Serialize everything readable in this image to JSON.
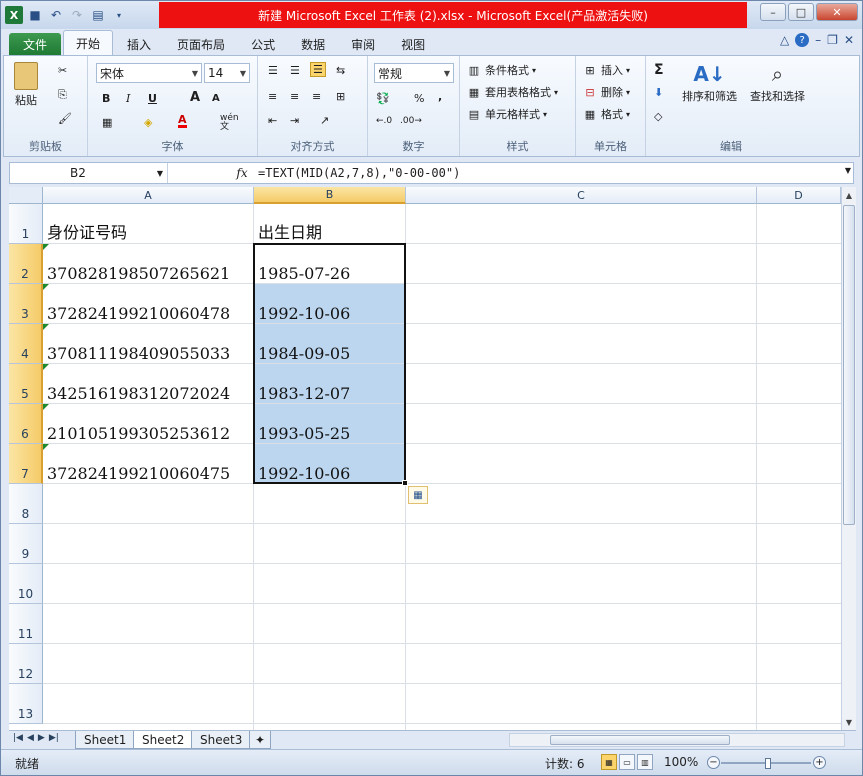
{
  "window": {
    "title": "新建 Microsoft Excel 工作表 (2).xlsx - Microsoft Excel(产品激活失败)"
  },
  "tabs": [
    "文件",
    "开始",
    "插入",
    "页面布局",
    "公式",
    "数据",
    "审阅",
    "视图"
  ],
  "ribbon": {
    "clipboard": {
      "paste": "粘贴",
      "label": "剪贴板"
    },
    "font": {
      "name": "宋体",
      "size": "14",
      "bold": "B",
      "italic": "I",
      "underline": "U",
      "grow": "A",
      "shrink": "A",
      "fontcolor": "A",
      "wen": "wén\n文",
      "label": "字体"
    },
    "align": {
      "label": "对齐方式"
    },
    "number": {
      "format": "常规",
      "percent": "%",
      "comma": ",",
      "label": "数字"
    },
    "styles": {
      "cond": "条件格式",
      "table": "套用表格格式",
      "cell": "单元格样式",
      "label": "样式"
    },
    "cells": {
      "insert": "插入",
      "delete": "删除",
      "format": "格式",
      "label": "单元格"
    },
    "editing": {
      "sort": "排序和筛选",
      "find": "查找和选择",
      "label": "编辑"
    }
  },
  "formula_bar": {
    "name_box": "B2",
    "fx": "fx",
    "formula": "=TEXT(MID(A2,7,8),\"0-00-00\")"
  },
  "grid": {
    "columns": [
      "A",
      "B",
      "C",
      "D"
    ],
    "rows": [
      "1",
      "2",
      "3",
      "4",
      "5",
      "6",
      "7",
      "8",
      "9",
      "10",
      "11",
      "12",
      "13"
    ],
    "header_A": "身份证号码",
    "header_B": "出生日期",
    "ids": [
      "370828198507265621",
      "372824199210060478",
      "370811198409055033",
      "342516198312072024",
      "210105199305253612",
      "372824199210060475"
    ],
    "dates": [
      "1985-07-26",
      "1992-10-06",
      "1984-09-05",
      "1983-12-07",
      "1993-05-25",
      "1992-10-06"
    ]
  },
  "sheets": [
    "Sheet1",
    "Sheet2",
    "Sheet3"
  ],
  "status": {
    "ready": "就绪",
    "count": "计数: 6",
    "zoom": "100%"
  }
}
